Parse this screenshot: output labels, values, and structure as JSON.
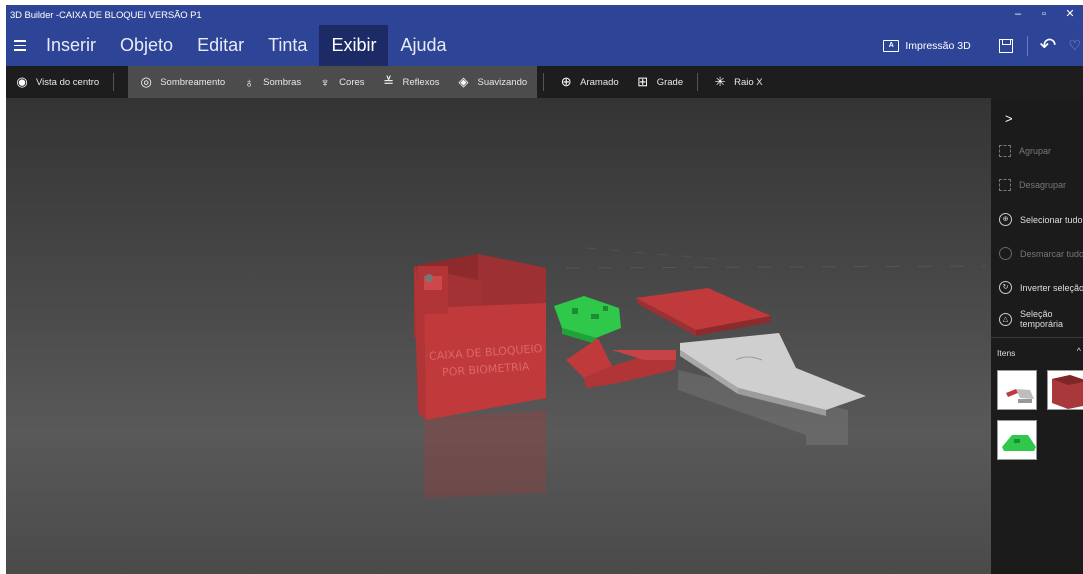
{
  "window": {
    "title": "3D Builder -CAIXA DE BLOQUEI VERSÃO P1",
    "minimize": "–",
    "maximize": "▫",
    "close": "✕"
  },
  "menu": {
    "items": [
      "Inserir",
      "Objeto",
      "Editar",
      "Tinta",
      "Exibir",
      "Ajuda"
    ],
    "active": "Exibir",
    "print3d_label": "Impressão 3D",
    "accent": "#2e4496"
  },
  "toolbar": {
    "center_view": "Vista do centro",
    "shading": "Sombreamento",
    "shadows": "Sombras",
    "colors": "Cores",
    "reflections": "Reflexos",
    "smoothing": "Suavizando",
    "wireframe": "Aramado",
    "grid": "Grade",
    "xray": "Raio X"
  },
  "panel": {
    "group": "Agrupar",
    "ungroup": "Desagrupar",
    "select_all": "Selecionar tudo",
    "deselect_all": "Desmarcar tudo",
    "invert_selection": "Inverter seleção",
    "temp_selection_line1": "Seleção",
    "temp_selection_line2": "temporária",
    "items_label": "Itens"
  },
  "scene": {
    "box_text_line1": "CAIXA DE BLOQUEIO",
    "box_text_line2": "POR BIOMETRIA",
    "colors": {
      "red": "#c0393b",
      "green": "#2fc84a",
      "gray": "#c9c9c9"
    }
  }
}
